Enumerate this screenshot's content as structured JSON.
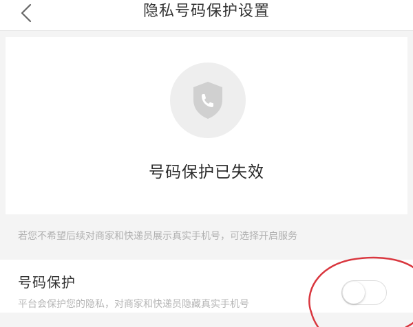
{
  "header": {
    "title": "隐私号码保护设置",
    "back_icon": "chevron-left-icon"
  },
  "status": {
    "icon": "shield-phone-icon",
    "title": "号码保护已失效"
  },
  "hint": "若您不希望后续对商家和快递员展示真实手机号，可选择开启服务",
  "setting": {
    "title": "号码保护",
    "description": "平台会保护您的隐私，对商家和快递员隐藏真实手机号",
    "toggle_enabled": false
  },
  "colors": {
    "page_background": "#f4f4f4",
    "card_background": "#ffffff",
    "icon_circle": "#eeeeee",
    "icon_shield": "#d0d0d0",
    "hint_text": "#b0b0b0",
    "annotation": "#d9363e"
  }
}
